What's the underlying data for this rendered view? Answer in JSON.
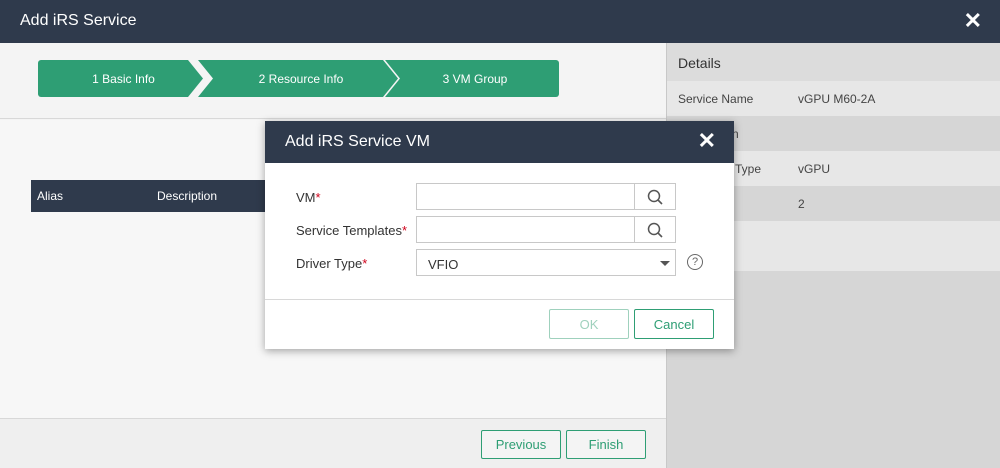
{
  "outer": {
    "title": "Add iRS Service"
  },
  "steps": [
    {
      "label": "1 Basic Info"
    },
    {
      "label": "2 Resource Info"
    },
    {
      "label": "3 VM Group"
    }
  ],
  "table": {
    "columns": [
      "Alias",
      "Description"
    ]
  },
  "footer": {
    "previous": "Previous",
    "finish": "Finish"
  },
  "details": {
    "heading": "Details",
    "rows": [
      {
        "key": "Service Name",
        "value": "vGPU M60-2A"
      },
      {
        "key": "n",
        "value": ""
      },
      {
        "key": "Type",
        "value": "vGPU"
      },
      {
        "key": "",
        "value": "2"
      }
    ]
  },
  "modal": {
    "title": "Add iRS Service VM",
    "fields": {
      "vm": {
        "label": "VM",
        "required": "*",
        "value": ""
      },
      "templates": {
        "label": "Service Templates",
        "required": "*",
        "value": ""
      },
      "driver": {
        "label": "Driver Type",
        "required": "*",
        "value": "VFIO"
      }
    },
    "ok": "OK",
    "cancel": "Cancel"
  },
  "colors": {
    "accent": "#2e9e74",
    "titlebar": "#2f3a4c",
    "required": "#d0021b"
  }
}
